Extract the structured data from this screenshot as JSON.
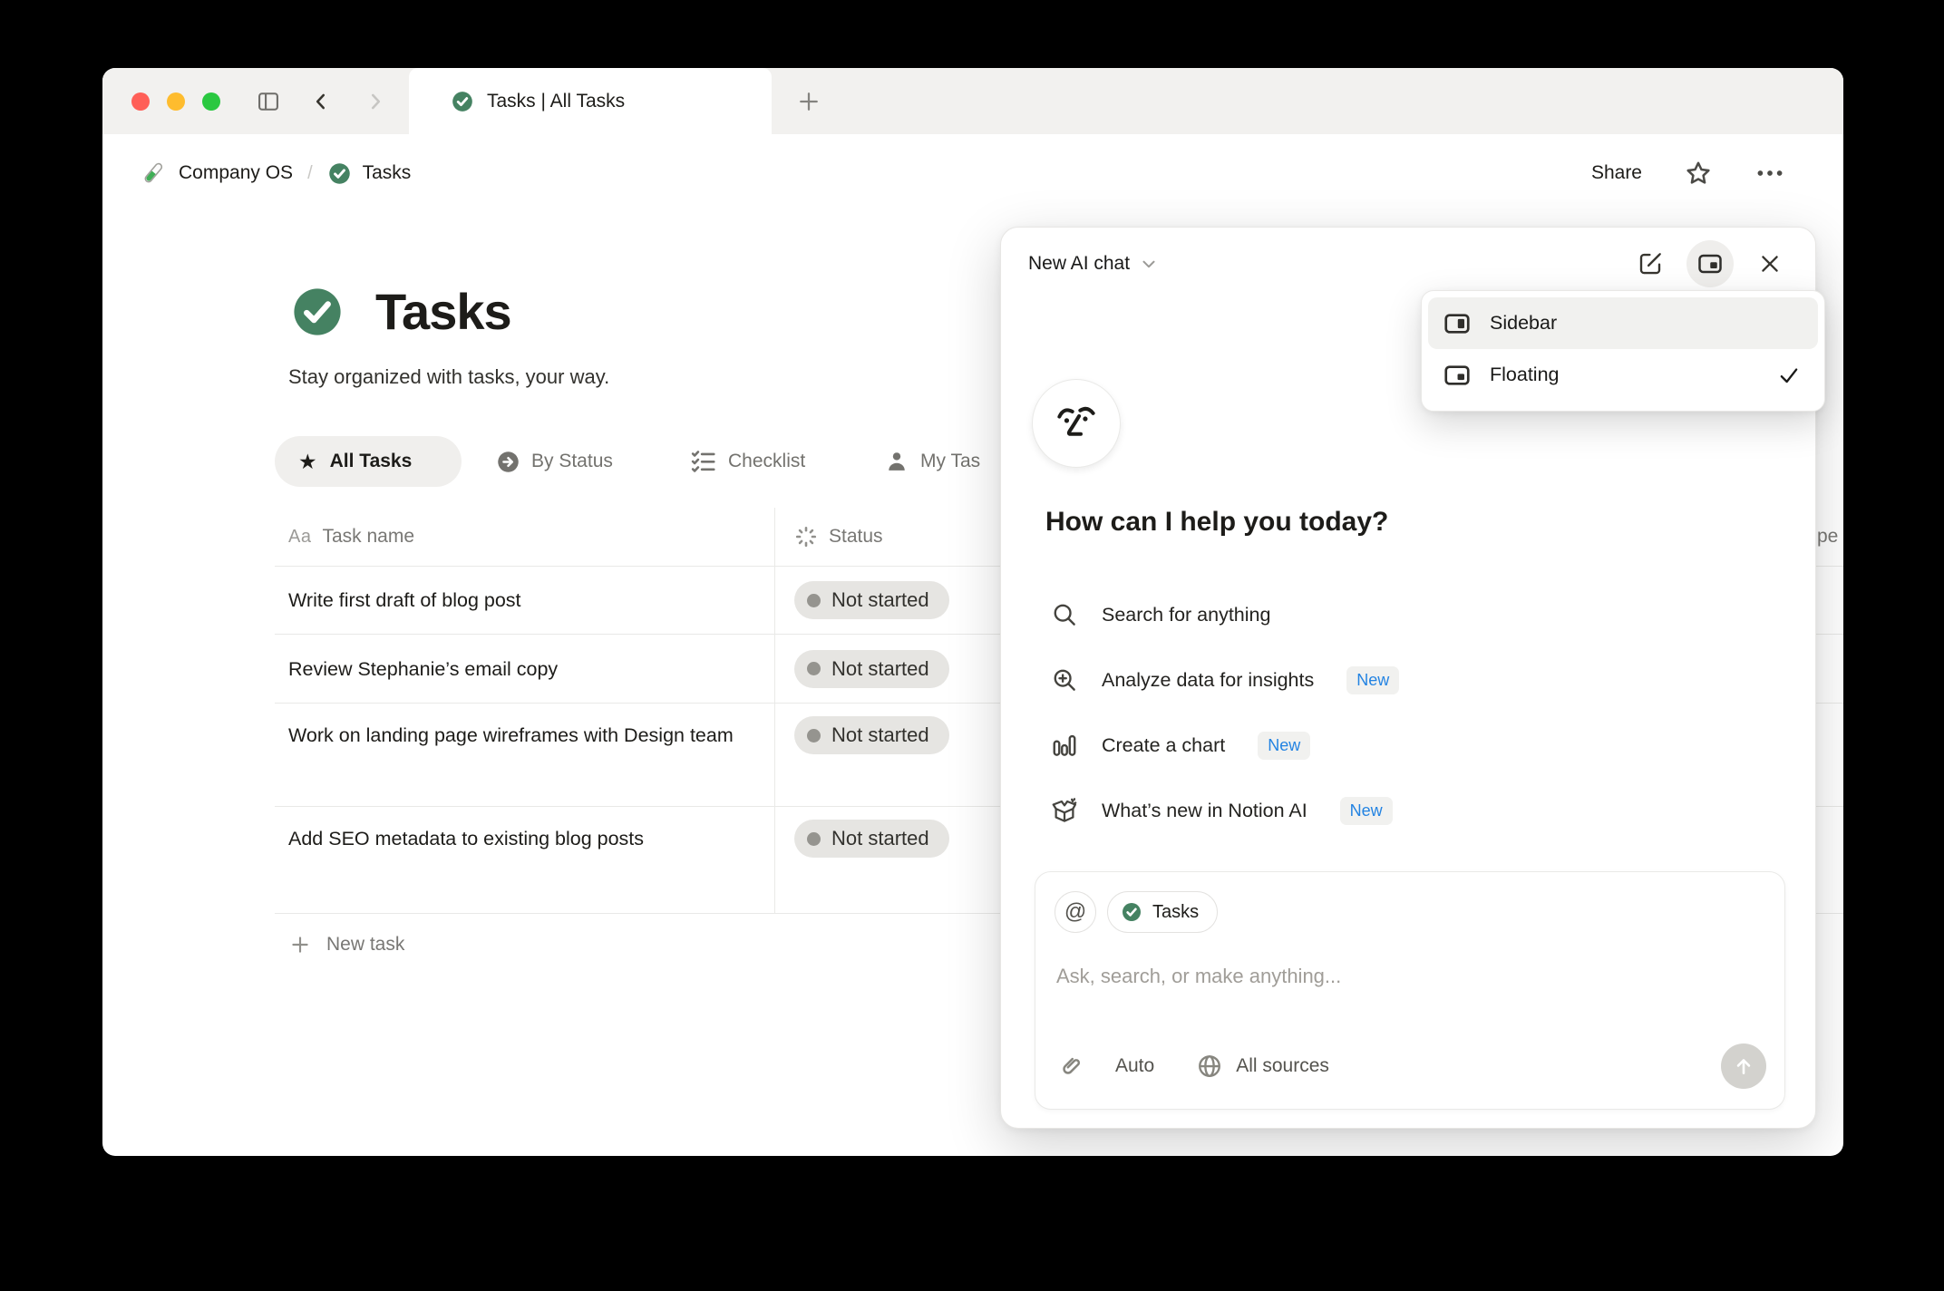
{
  "tabbar": {
    "tab_title": "Tasks | All Tasks"
  },
  "breadcrumb": {
    "workspace": "Company OS",
    "separator": "/",
    "page": "Tasks"
  },
  "top_actions": {
    "share_label": "Share"
  },
  "page": {
    "title": "Tasks",
    "subtitle": "Stay organized with tasks, your way.",
    "views": [
      {
        "label": "All Tasks",
        "icon": "star-icon",
        "active": true
      },
      {
        "label": "By Status",
        "icon": "arrow-circle-icon",
        "active": false
      },
      {
        "label": "Checklist",
        "icon": "checklist-icon",
        "active": false
      },
      {
        "label": "My Tas",
        "icon": "person-icon",
        "active": false,
        "clipped": true
      }
    ],
    "table": {
      "columns": [
        {
          "label": "Task name",
          "icon": "text-icon"
        },
        {
          "label": "Status",
          "icon": "spinner-icon"
        },
        {
          "label": "pe",
          "partial": true
        }
      ],
      "rows": [
        {
          "task": "Write first draft of blog post",
          "status": "Not started"
        },
        {
          "task": "Review Stephanie’s email copy",
          "status": "Not started"
        },
        {
          "task": "Work on landing page wireframes with Design team",
          "status": "Not started"
        },
        {
          "task": "Add SEO metadata to existing blog posts",
          "status": "Not started"
        }
      ],
      "new_task_label": "New task"
    }
  },
  "ai_panel": {
    "header_title": "New AI chat",
    "greeting": "How can I help you today?",
    "suggestions": [
      {
        "label": "Search for anything",
        "icon": "search-icon",
        "badge": ""
      },
      {
        "label": "Analyze data for insights",
        "icon": "zoom-in-icon",
        "badge": "New"
      },
      {
        "label": "Create a chart",
        "icon": "bar-chart-icon",
        "badge": "New"
      },
      {
        "label": "What’s new in Notion AI",
        "icon": "gift-box-icon",
        "badge": "New"
      }
    ],
    "composer": {
      "context_chip": "Tasks",
      "placeholder": "Ask, search, or make anything...",
      "mode_label": "Auto",
      "sources_label": "All sources"
    }
  },
  "dropdown": {
    "items": [
      {
        "label": "Sidebar",
        "selected": false
      },
      {
        "label": "Floating",
        "selected": true
      }
    ]
  },
  "colors": {
    "accent_green": "#458262",
    "badge_blue": "#2383e2",
    "status_pill_bg": "#e6e5e2",
    "traffic_red": "#ff5f57",
    "traffic_yellow": "#febc2e",
    "traffic_green": "#2ac840"
  }
}
